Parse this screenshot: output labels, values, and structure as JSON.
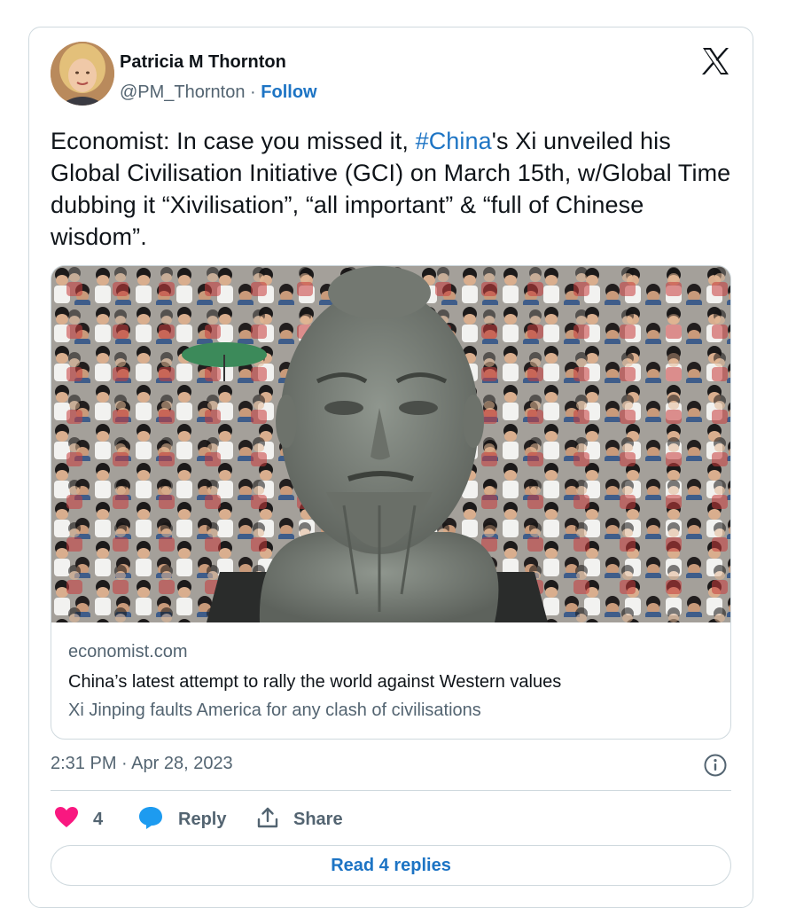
{
  "author": {
    "name": "Patricia M Thornton",
    "handle": "@PM_Thornton",
    "separator": " · ",
    "follow_label": "Follow"
  },
  "tweet": {
    "text_before": "Economist: In case you missed it, ",
    "hashtag": "#China",
    "text_after": "'s Xi unveiled his Global Civilisation Initiative (GCI) on March 15th, w/Global Time dubbing it “Xivilisation”, “all important” & “full of Chinese wisdom”."
  },
  "link_card": {
    "domain": "economist.com",
    "title": "China’s latest attempt to rally the world against Western values",
    "description": "Xi Jinping faults America for any clash of civilisations"
  },
  "meta": {
    "timestamp": "2:31 PM · Apr 28, 2023"
  },
  "actions": {
    "like_count": "4",
    "reply_label": "Reply",
    "share_label": "Share"
  },
  "read_replies_label": "Read 4 replies",
  "colors": {
    "link": "#1d74c4",
    "like": "#f91880",
    "reply_icon": "#1d9bf0",
    "text": "#0f1419",
    "secondary": "#536471",
    "border": "#cfd9de"
  },
  "icons": [
    "x-logo-icon",
    "info-icon",
    "heart-icon",
    "reply-bubble-icon",
    "share-icon"
  ]
}
